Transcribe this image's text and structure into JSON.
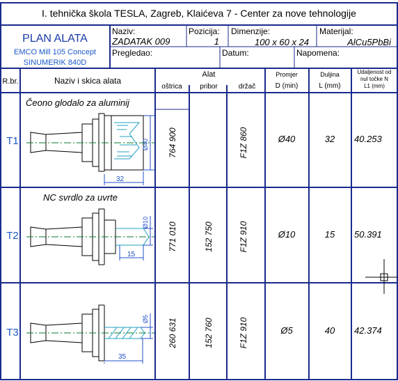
{
  "header": {
    "school": "I. tehnička škola TESLA, Zagreb, Klaićeva 7    -   Center za nove tehnologije"
  },
  "title_block": {
    "plan_title": "PLAN ALATA",
    "machine_line1": "EMCO Mill 105 Concept",
    "machine_line2": "SINUMERIK 840D",
    "naziv_label": "Naziv:",
    "naziv_value": "ZADATAK 009",
    "pozicija_label": "Pozicija:",
    "pozicija_value": "1",
    "dimenzije_label": "Dimenzije:",
    "dimenzije_value": "100 x 60 x 24",
    "materijal_label": "Materijal:",
    "materijal_value": "AlCu5PbBi",
    "pregledao_label": "Pregledao:",
    "datum_label": "Datum:",
    "napomena_label": "Napomena:"
  },
  "columns": {
    "rbr": "R.br.",
    "naziv": "Naziv i skica alata",
    "alat": "Alat",
    "ostrica": "oštrica",
    "pribor": "pribor",
    "drzac": "držač",
    "promjer": "Promjer",
    "promjer_unit": "D (min)",
    "duljina": "Duljina",
    "duljina_unit": "L (mm)",
    "udaljenost_1": "Udaljenost od",
    "udaljenost_2": "nul točke N",
    "udaljenost_3": "L1 (mm)"
  },
  "tools": [
    {
      "id": "T1",
      "name": "Čeono glodalo za aluminij",
      "ostrica": "764 900",
      "pribor": "",
      "drzac": "F1Z 860",
      "diameter": "Ø40",
      "length": "32",
      "offset": "40.253",
      "dim_diameter": "Ø40",
      "dim_length": "32"
    },
    {
      "id": "T2",
      "name": "NC svrdlo za uvrte",
      "ostrica": "771 010",
      "pribor": "152 750",
      "drzac": "F1Z 910",
      "diameter": "Ø10",
      "length": "15",
      "offset": "50.391",
      "dim_diameter": "Ø10",
      "dim_length": "15"
    },
    {
      "id": "T3",
      "name": "",
      "ostrica": "260 631",
      "pribor": "152 760",
      "drzac": "F1Z 910",
      "diameter": "Ø5",
      "length": "40",
      "offset": "42.374",
      "dim_diameter": "Ø5",
      "dim_length": "35"
    }
  ],
  "colors": {
    "frame": "#1a2a8c",
    "id_blue": "#1a58c8",
    "hatch": "#20a0c0",
    "centerline": "#0a7a2a",
    "dim_blue": "#1f50c8"
  }
}
